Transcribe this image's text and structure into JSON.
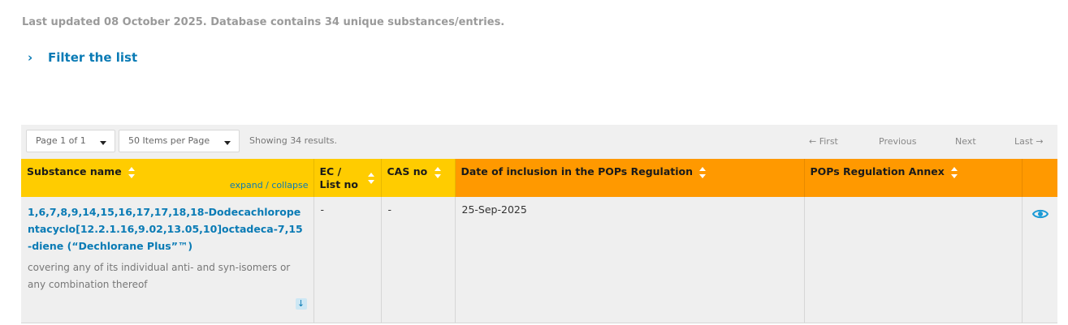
{
  "header": {
    "updated_text": "Last updated 08 October 2025. Database contains 34 unique substances/entries.",
    "filter_label": "Filter the list"
  },
  "toolbar": {
    "page_select": "Page 1 of 1",
    "items_select": "50 Items per Page",
    "showing": "Showing 34 results.",
    "first": "← First",
    "previous": "Previous",
    "next": "Next",
    "last": "Last →"
  },
  "table": {
    "columns": {
      "substance_name": "Substance name",
      "expand_collapse": "expand / collapse",
      "ec_list_no_line1": "EC /",
      "ec_list_no_line2": "List no",
      "cas_no": "CAS no",
      "date_inclusion": "Date of inclusion in the POPs Regulation",
      "pops_annex": "POPs Regulation Annex"
    },
    "rows": [
      {
        "substance_name": "1,6,7,8,9,14,15,16,17,17,18,18-Dodecachloropentacyclo[12.2.1.16,9.02,13.05,10]octadeca-7,15-diene (“Dechlorane Plus”™)",
        "description": "covering any of its individual anti- and syn-isomers or any combination thereof",
        "ec_list_no": "-",
        "cas_no": "-",
        "date_inclusion": "25-Sep-2025",
        "pops_annex": ""
      }
    ]
  },
  "colors": {
    "accent_blue": "#0a7bb5",
    "header_yellow": "#ffcc00",
    "header_orange": "#ff9900"
  },
  "icons": {
    "filter_toggle": "chevron-right-icon",
    "sort": "sort-icon",
    "expand_row": "arrow-down-icon",
    "view": "eye-icon"
  }
}
